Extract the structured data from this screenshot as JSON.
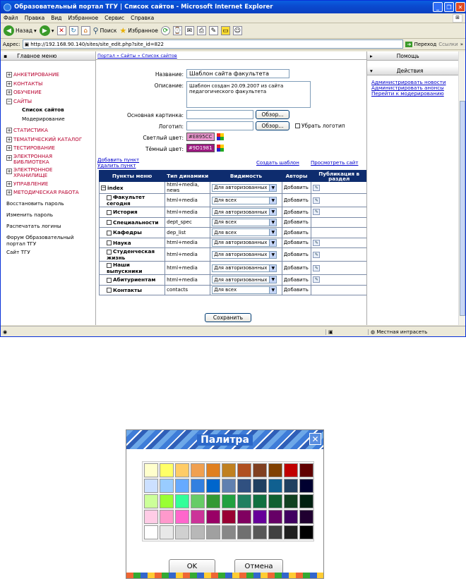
{
  "window": {
    "title": "Образовательный портал ТГУ | Список сайтов - Microsoft Internet Explorer"
  },
  "menubar": [
    "Файл",
    "Правка",
    "Вид",
    "Избранное",
    "Сервис",
    "Справка"
  ],
  "toolbar": {
    "back": "Назад",
    "search": "Поиск",
    "favorites": "Избранное"
  },
  "address": {
    "label": "Адрес:",
    "url": "http://192.168.90.140/sites/site_edit.php?site_id=822",
    "go": "Переход",
    "links": "Ссылки"
  },
  "left": {
    "header": "Главное меню",
    "items": [
      {
        "label": "АНКЕТИРОВАНИЕ",
        "mark": "+"
      },
      {
        "label": "КОНТАКТЫ",
        "mark": "+"
      },
      {
        "label": "ОБУЧЕНИЕ",
        "mark": "+"
      },
      {
        "label": "САЙТЫ",
        "mark": "−"
      }
    ],
    "subs": [
      "Список сайтов",
      "Модерирование"
    ],
    "items2": [
      {
        "label": "СТАТИСТИКА",
        "mark": "+"
      },
      {
        "label": "ТЕМАТИЧЕСКИЙ КАТАЛОГ",
        "mark": "+"
      },
      {
        "label": "ТЕСТИРОВАНИЕ",
        "mark": "+"
      },
      {
        "label": "ЭЛЕКТРОННАЯ БИБЛИОТЕКА",
        "mark": "+"
      },
      {
        "label": "ЭЛЕКТРОННОЕ ХРАНИЛИЩЕ",
        "mark": "+"
      },
      {
        "label": "УПРАВЛЕНИЕ",
        "mark": "+"
      },
      {
        "label": "МЕТОДИЧЕСКАЯ РАБОТА",
        "mark": "+"
      }
    ],
    "plain": [
      "Восстановить пароль",
      "Изменить пароль",
      "Распечатать логины",
      "Форум Образовательный портал ТГУ",
      "Сайт ТГУ"
    ]
  },
  "breadcrumb": "Портал » Сайты » Список сайтов",
  "form": {
    "name_label": "Название:",
    "name_value": "Шаблон сайта факультета",
    "desc_label": "Описание:",
    "desc_value": "Шаблон создан 20.09.2007 из сайта педагогического факультета",
    "pic_label": "Основная картинка:",
    "browse": "Обзор...",
    "logo_label": "Логотип:",
    "remove_logo": "Убрать логотип",
    "light_label": "Светлый цвет:",
    "light_value": "#E895CC",
    "dark_label": "Тёмный цвет:",
    "dark_value": "#9D1981"
  },
  "links": {
    "add": "Добавить пункт",
    "del": "Удалить пункт",
    "create": "Создать шаблон",
    "view": "Просмотреть сайт"
  },
  "table": {
    "headers": [
      "Пункты меню",
      "Тип динамики",
      "Видимость",
      "Авторы",
      "Публикация в раздел"
    ],
    "rows": [
      {
        "name": "index",
        "type": "html+media, news",
        "vis": "Для авторизованных",
        "auth": "Добавить",
        "pub": true,
        "mark": "−"
      },
      {
        "name": "Факультет сегодня",
        "type": "html+media",
        "vis": "Для всех",
        "auth": "Добавить",
        "pub": true,
        "mark": ""
      },
      {
        "name": "История",
        "type": "html+media",
        "vis": "Для авторизованных",
        "auth": "Добавить",
        "pub": true,
        "mark": ""
      },
      {
        "name": "Специальности",
        "type": "dept_spec",
        "vis": "Для всех",
        "auth": "Добавить",
        "pub": false,
        "mark": ""
      },
      {
        "name": "Кафедры",
        "type": "dep_list",
        "vis": "Для всех",
        "auth": "Добавить",
        "pub": false,
        "mark": ""
      },
      {
        "name": "Наука",
        "type": "html+media",
        "vis": "Для авторизованных",
        "auth": "Добавить",
        "pub": true,
        "mark": ""
      },
      {
        "name": "Студенческая жизнь",
        "type": "html+media",
        "vis": "Для авторизованных",
        "auth": "Добавить",
        "pub": true,
        "mark": ""
      },
      {
        "name": "Наши выпускники",
        "type": "html+media",
        "vis": "Для авторизованных",
        "auth": "Добавить",
        "pub": true,
        "mark": ""
      },
      {
        "name": "Абитуриентам",
        "type": "html+media",
        "vis": "Для авторизованных",
        "auth": "Добавить",
        "pub": true,
        "mark": ""
      },
      {
        "name": "Контакты",
        "type": "contacts",
        "vis": "Для всех",
        "auth": "Добавить",
        "pub": false,
        "mark": ""
      }
    ],
    "save": "Сохранить"
  },
  "right": {
    "help": "Помощь",
    "actions": "Действия",
    "links": [
      "Администрировать новости",
      "Администрировать анонсы",
      "Перейти к модерированию"
    ]
  },
  "status": {
    "zone": "Местная интрасеть"
  },
  "palette": {
    "title": "Палитра",
    "ok": "OK",
    "cancel": "Отмена",
    "colors": [
      "#ffffcc",
      "#ffff66",
      "#ffcc66",
      "#f0a050",
      "#e08020",
      "#c08020",
      "#b05020",
      "#804020",
      "#804000",
      "#c00000",
      "#600000",
      "#cce0ff",
      "#99ccff",
      "#66aaff",
      "#3380e0",
      "#0066cc",
      "#6080b0",
      "#305080",
      "#204060",
      "#106090",
      "#204060",
      "#000030",
      "#ccff99",
      "#99ff33",
      "#33ff99",
      "#66cc66",
      "#339933",
      "#20a040",
      "#208060",
      "#107040",
      "#106030",
      "#104020",
      "#002010",
      "#ffcce6",
      "#ff99cc",
      "#ff66cc",
      "#cc3399",
      "#990066",
      "#990033",
      "#800060",
      "#660099",
      "#660066",
      "#400060",
      "#200030",
      "#ffffff",
      "#e8e8e8",
      "#d0d0d0",
      "#b8b8b8",
      "#a0a0a0",
      "#888888",
      "#707070",
      "#585858",
      "#404040",
      "#202020",
      "#000000"
    ]
  }
}
